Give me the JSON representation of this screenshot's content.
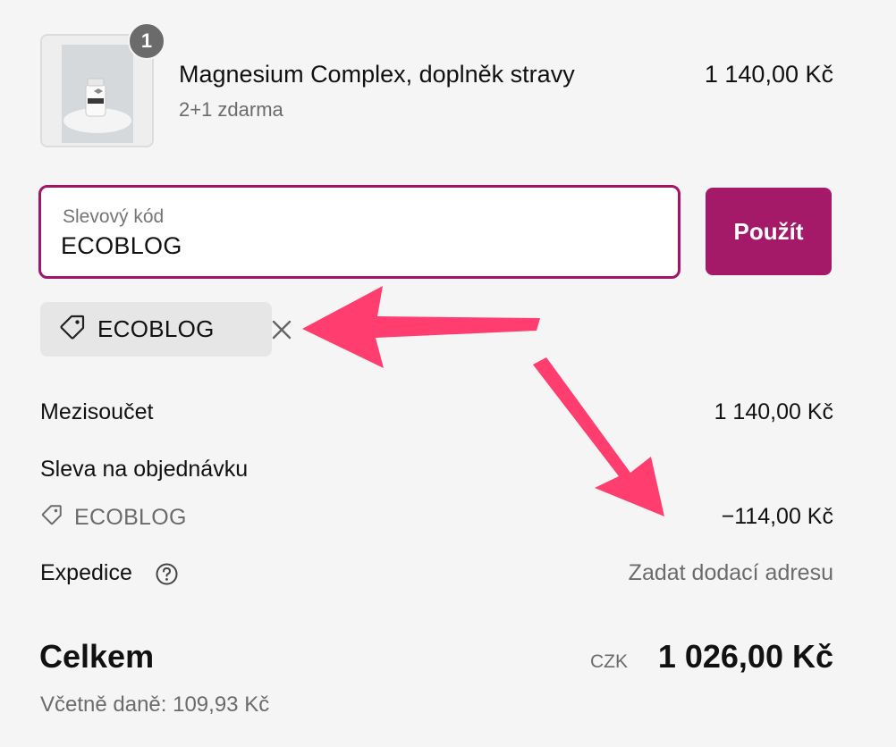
{
  "product": {
    "quantity": "1",
    "name": "Magnesium Complex, doplněk stravy",
    "variant": "2+1 zdarma",
    "price": "1 140,00 Kč",
    "image_icon": "product-bottle-image"
  },
  "discount": {
    "label": "Slevový kód",
    "value": "ECOBLOG",
    "apply_label": "Použít",
    "applied_code": "ECOBLOG",
    "tag_icon": "tag-icon",
    "remove_icon": "close-icon"
  },
  "summary": {
    "subtotal_label": "Mezisoučet",
    "subtotal_value": "1 140,00 Kč",
    "order_discount_label": "Sleva na objednávku",
    "order_discount_code": "ECOBLOG",
    "order_discount_value": "−114,00 Kč",
    "shipping_label": "Expedice",
    "shipping_help_icon": "question-circle-icon",
    "shipping_value": "Zadat dodací adresu"
  },
  "total": {
    "label": "Celkem",
    "currency": "CZK",
    "value": "1 026,00 Kč",
    "tax_line": "Včetně daně: 109,93 Kč"
  },
  "colors": {
    "accent": "#a41a68",
    "annotation_arrow": "#ff3d6e",
    "background": "#f5f5f5"
  }
}
